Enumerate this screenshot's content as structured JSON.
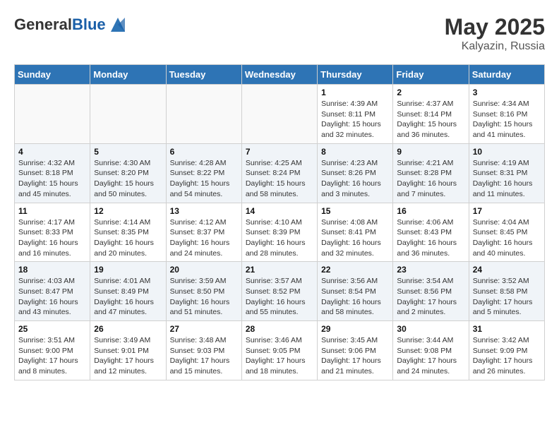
{
  "header": {
    "logo_general": "General",
    "logo_blue": "Blue",
    "month_year": "May 2025",
    "location": "Kalyazin, Russia"
  },
  "weekdays": [
    "Sunday",
    "Monday",
    "Tuesday",
    "Wednesday",
    "Thursday",
    "Friday",
    "Saturday"
  ],
  "weeks": [
    [
      {
        "day": "",
        "info": ""
      },
      {
        "day": "",
        "info": ""
      },
      {
        "day": "",
        "info": ""
      },
      {
        "day": "",
        "info": ""
      },
      {
        "day": "1",
        "info": "Sunrise: 4:39 AM\nSunset: 8:11 PM\nDaylight: 15 hours\nand 32 minutes."
      },
      {
        "day": "2",
        "info": "Sunrise: 4:37 AM\nSunset: 8:14 PM\nDaylight: 15 hours\nand 36 minutes."
      },
      {
        "day": "3",
        "info": "Sunrise: 4:34 AM\nSunset: 8:16 PM\nDaylight: 15 hours\nand 41 minutes."
      }
    ],
    [
      {
        "day": "4",
        "info": "Sunrise: 4:32 AM\nSunset: 8:18 PM\nDaylight: 15 hours\nand 45 minutes."
      },
      {
        "day": "5",
        "info": "Sunrise: 4:30 AM\nSunset: 8:20 PM\nDaylight: 15 hours\nand 50 minutes."
      },
      {
        "day": "6",
        "info": "Sunrise: 4:28 AM\nSunset: 8:22 PM\nDaylight: 15 hours\nand 54 minutes."
      },
      {
        "day": "7",
        "info": "Sunrise: 4:25 AM\nSunset: 8:24 PM\nDaylight: 15 hours\nand 58 minutes."
      },
      {
        "day": "8",
        "info": "Sunrise: 4:23 AM\nSunset: 8:26 PM\nDaylight: 16 hours\nand 3 minutes."
      },
      {
        "day": "9",
        "info": "Sunrise: 4:21 AM\nSunset: 8:28 PM\nDaylight: 16 hours\nand 7 minutes."
      },
      {
        "day": "10",
        "info": "Sunrise: 4:19 AM\nSunset: 8:31 PM\nDaylight: 16 hours\nand 11 minutes."
      }
    ],
    [
      {
        "day": "11",
        "info": "Sunrise: 4:17 AM\nSunset: 8:33 PM\nDaylight: 16 hours\nand 16 minutes."
      },
      {
        "day": "12",
        "info": "Sunrise: 4:14 AM\nSunset: 8:35 PM\nDaylight: 16 hours\nand 20 minutes."
      },
      {
        "day": "13",
        "info": "Sunrise: 4:12 AM\nSunset: 8:37 PM\nDaylight: 16 hours\nand 24 minutes."
      },
      {
        "day": "14",
        "info": "Sunrise: 4:10 AM\nSunset: 8:39 PM\nDaylight: 16 hours\nand 28 minutes."
      },
      {
        "day": "15",
        "info": "Sunrise: 4:08 AM\nSunset: 8:41 PM\nDaylight: 16 hours\nand 32 minutes."
      },
      {
        "day": "16",
        "info": "Sunrise: 4:06 AM\nSunset: 8:43 PM\nDaylight: 16 hours\nand 36 minutes."
      },
      {
        "day": "17",
        "info": "Sunrise: 4:04 AM\nSunset: 8:45 PM\nDaylight: 16 hours\nand 40 minutes."
      }
    ],
    [
      {
        "day": "18",
        "info": "Sunrise: 4:03 AM\nSunset: 8:47 PM\nDaylight: 16 hours\nand 43 minutes."
      },
      {
        "day": "19",
        "info": "Sunrise: 4:01 AM\nSunset: 8:49 PM\nDaylight: 16 hours\nand 47 minutes."
      },
      {
        "day": "20",
        "info": "Sunrise: 3:59 AM\nSunset: 8:50 PM\nDaylight: 16 hours\nand 51 minutes."
      },
      {
        "day": "21",
        "info": "Sunrise: 3:57 AM\nSunset: 8:52 PM\nDaylight: 16 hours\nand 55 minutes."
      },
      {
        "day": "22",
        "info": "Sunrise: 3:56 AM\nSunset: 8:54 PM\nDaylight: 16 hours\nand 58 minutes."
      },
      {
        "day": "23",
        "info": "Sunrise: 3:54 AM\nSunset: 8:56 PM\nDaylight: 17 hours\nand 2 minutes."
      },
      {
        "day": "24",
        "info": "Sunrise: 3:52 AM\nSunset: 8:58 PM\nDaylight: 17 hours\nand 5 minutes."
      }
    ],
    [
      {
        "day": "25",
        "info": "Sunrise: 3:51 AM\nSunset: 9:00 PM\nDaylight: 17 hours\nand 8 minutes."
      },
      {
        "day": "26",
        "info": "Sunrise: 3:49 AM\nSunset: 9:01 PM\nDaylight: 17 hours\nand 12 minutes."
      },
      {
        "day": "27",
        "info": "Sunrise: 3:48 AM\nSunset: 9:03 PM\nDaylight: 17 hours\nand 15 minutes."
      },
      {
        "day": "28",
        "info": "Sunrise: 3:46 AM\nSunset: 9:05 PM\nDaylight: 17 hours\nand 18 minutes."
      },
      {
        "day": "29",
        "info": "Sunrise: 3:45 AM\nSunset: 9:06 PM\nDaylight: 17 hours\nand 21 minutes."
      },
      {
        "day": "30",
        "info": "Sunrise: 3:44 AM\nSunset: 9:08 PM\nDaylight: 17 hours\nand 24 minutes."
      },
      {
        "day": "31",
        "info": "Sunrise: 3:42 AM\nSunset: 9:09 PM\nDaylight: 17 hours\nand 26 minutes."
      }
    ]
  ]
}
